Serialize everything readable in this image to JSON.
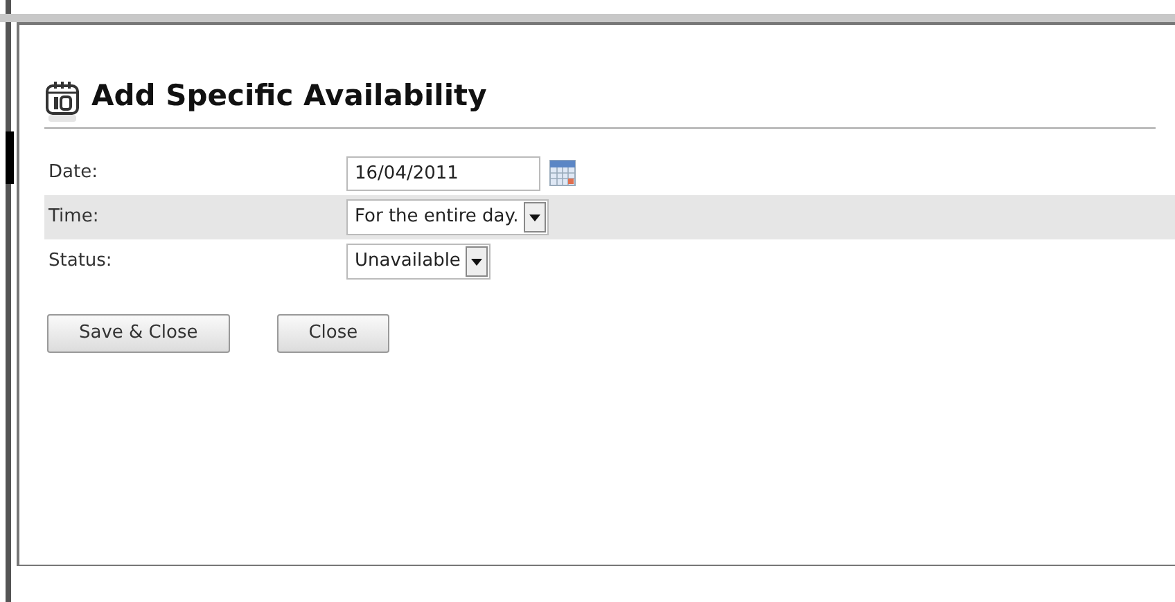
{
  "dialog": {
    "title": "Add Specific Availability"
  },
  "fields": [
    {
      "kind": "date",
      "label": "Date:",
      "value": "16/04/2011",
      "highlighted": false
    },
    {
      "kind": "select",
      "label": "Time:",
      "value": "For the entire day.",
      "highlighted": true
    },
    {
      "kind": "select",
      "label": "Status:",
      "value": "Unavailable",
      "highlighted": false
    }
  ],
  "buttons": [
    "Save & Close",
    "Close"
  ]
}
